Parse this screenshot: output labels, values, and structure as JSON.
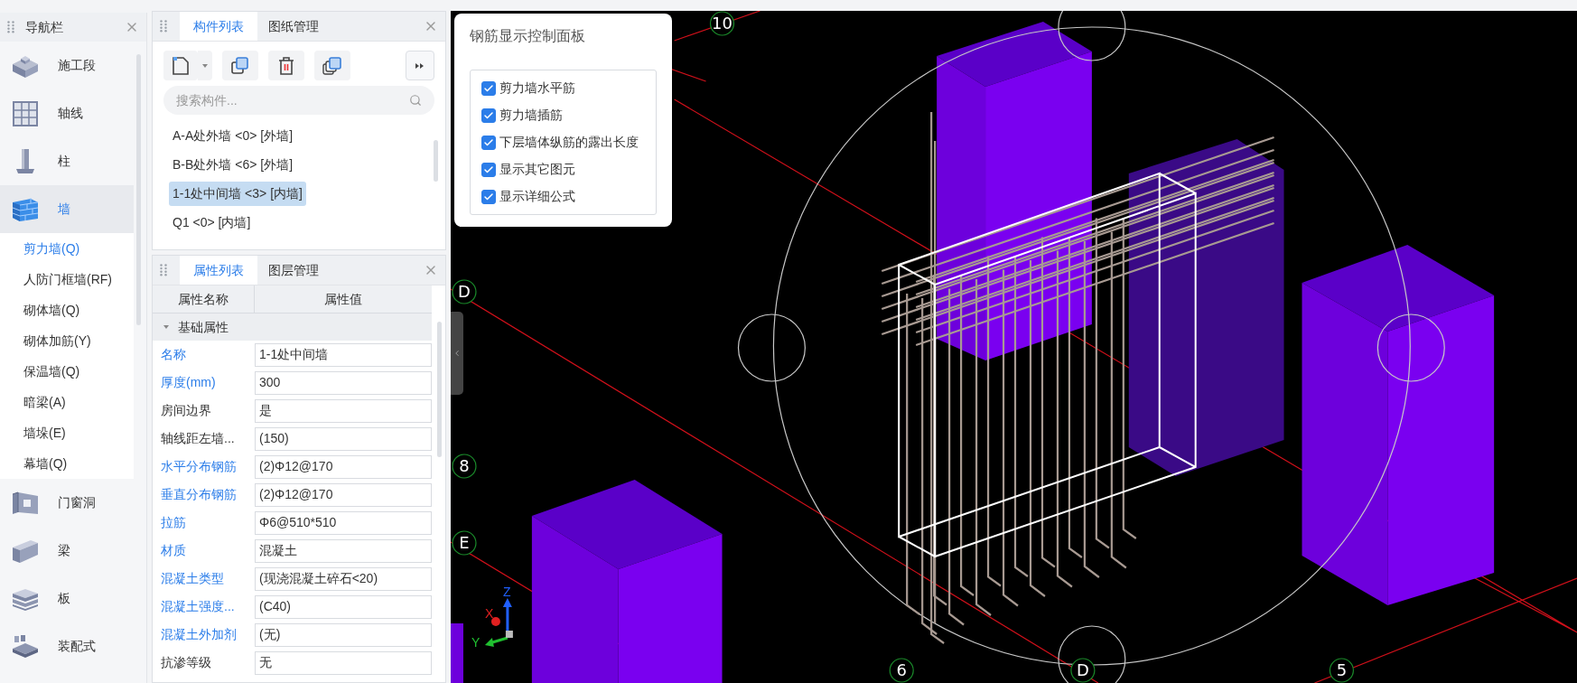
{
  "nav": {
    "title": "导航栏",
    "items": [
      {
        "label": "施工段",
        "selected": false
      },
      {
        "label": "轴线",
        "selected": false
      },
      {
        "label": "柱",
        "selected": false
      },
      {
        "label": "墙",
        "selected": true,
        "expanded": true,
        "children": [
          {
            "label": "剪力墙(Q)",
            "selected": true
          },
          {
            "label": "人防门框墙(RF)",
            "selected": false
          },
          {
            "label": "砌体墙(Q)",
            "selected": false
          },
          {
            "label": "砌体加筋(Y)",
            "selected": false
          },
          {
            "label": "保温墙(Q)",
            "selected": false
          },
          {
            "label": "暗梁(A)",
            "selected": false
          },
          {
            "label": "墙垛(E)",
            "selected": false
          },
          {
            "label": "幕墙(Q)",
            "selected": false
          }
        ]
      },
      {
        "label": "门窗洞",
        "selected": false
      },
      {
        "label": "梁",
        "selected": false
      },
      {
        "label": "板",
        "selected": false
      },
      {
        "label": "装配式",
        "selected": false
      }
    ]
  },
  "component_panel": {
    "tabs": [
      {
        "label": "构件列表",
        "selected": true
      },
      {
        "label": "图纸管理",
        "selected": false
      }
    ],
    "search": {
      "placeholder": "搜索构件..."
    },
    "items": [
      {
        "label": "A-A处外墙 <0> [外墙]",
        "selected": false
      },
      {
        "label": "B-B处外墙 <6> [外墙]",
        "selected": false
      },
      {
        "label": "1-1处中间墙 <3> [内墙]",
        "selected": true
      },
      {
        "label": "Q1 <0> [内墙]",
        "selected": false
      }
    ]
  },
  "property_panel": {
    "tabs": [
      {
        "label": "属性列表",
        "selected": true
      },
      {
        "label": "图层管理",
        "selected": false
      }
    ],
    "columns": [
      "属性名称",
      "属性值"
    ],
    "group": {
      "label": "基础属性",
      "expanded": true
    },
    "rows": [
      {
        "name": "名称",
        "value": "1-1处中间墙",
        "public": true
      },
      {
        "name": "厚度(mm)",
        "value": "300",
        "public": true
      },
      {
        "name": "房间边界",
        "value": "是",
        "public": false
      },
      {
        "name": "轴线距左墙...",
        "value": "(150)",
        "public": false
      },
      {
        "name": "水平分布钢筋",
        "value": "(2)Φ12@170",
        "public": true
      },
      {
        "name": "垂直分布钢筋",
        "value": "(2)Φ12@170",
        "public": true
      },
      {
        "name": "拉筋",
        "value": "Φ6@510*510",
        "public": true
      },
      {
        "name": "材质",
        "value": "混凝土",
        "public": true
      },
      {
        "name": "混凝土类型",
        "value": "(现浇混凝土碎石<20)",
        "public": true
      },
      {
        "name": "混凝土强度...",
        "value": "(C40)",
        "public": true
      },
      {
        "name": "混凝土外加剂",
        "value": "(无)",
        "public": true
      },
      {
        "name": "抗渗等级",
        "value": "无",
        "public": false
      }
    ]
  },
  "rebar_panel": {
    "title": "钢筋显示控制面板",
    "options": [
      {
        "label": "剪力墙水平筋",
        "checked": true
      },
      {
        "label": "剪力墙插筋",
        "checked": true
      },
      {
        "label": "下层墙体纵筋的露出长度",
        "checked": true
      },
      {
        "label": "显示其它图元",
        "checked": true
      },
      {
        "label": "显示详细公式",
        "checked": true
      }
    ]
  },
  "viewport": {
    "grid_labels": [
      "10",
      "D",
      "8",
      "E",
      "6",
      "D",
      "5"
    ],
    "axes": [
      "X",
      "Y",
      "Z"
    ]
  }
}
